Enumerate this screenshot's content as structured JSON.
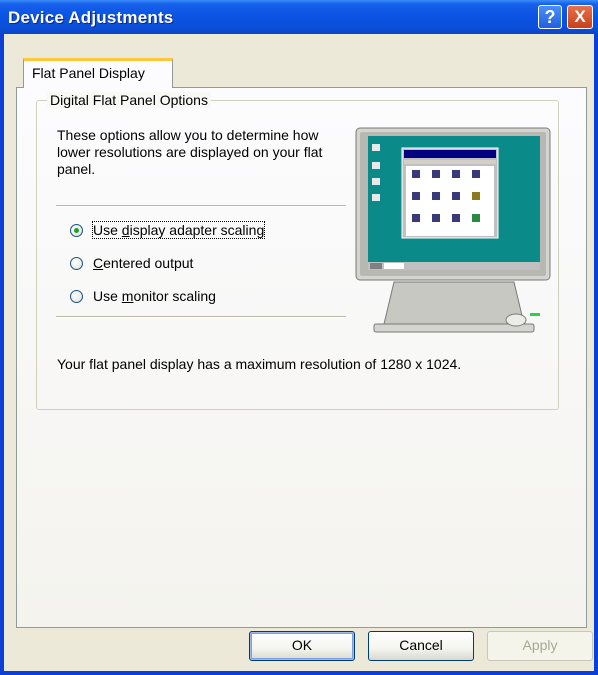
{
  "window": {
    "title": "Device Adjustments",
    "help_glyph": "?",
    "close_glyph": "X"
  },
  "tabs": [
    {
      "label": "Flat Panel Display",
      "active": true
    }
  ],
  "group": {
    "title": "Digital Flat Panel Options",
    "description": "These options allow you to determine how lower resolutions are displayed on your flat panel."
  },
  "options": [
    {
      "pre": "Use ",
      "mnemonic": "d",
      "post": "isplay adapter scaling",
      "checked": true
    },
    {
      "pre": "",
      "mnemonic": "C",
      "post": "entered output",
      "checked": false
    },
    {
      "pre": "Use ",
      "mnemonic": "m",
      "post": "onitor scaling",
      "checked": false
    }
  ],
  "info": {
    "max_resolution_text": "Your flat panel display has a maximum resolution of 1280 x 1024."
  },
  "buttons": {
    "ok": "OK",
    "cancel": "Cancel",
    "apply": "Apply"
  },
  "icons": {
    "help": "help-icon",
    "close": "close-icon",
    "monitor": "monitor-illustration"
  },
  "colors": {
    "titlebar": "#0a53e3",
    "dialog_face": "#ece9d8",
    "tab_highlight": "#ffc83c",
    "desktop_teal": "#008080",
    "close_button": "#c8401b",
    "radio_dot": "#21a121"
  }
}
